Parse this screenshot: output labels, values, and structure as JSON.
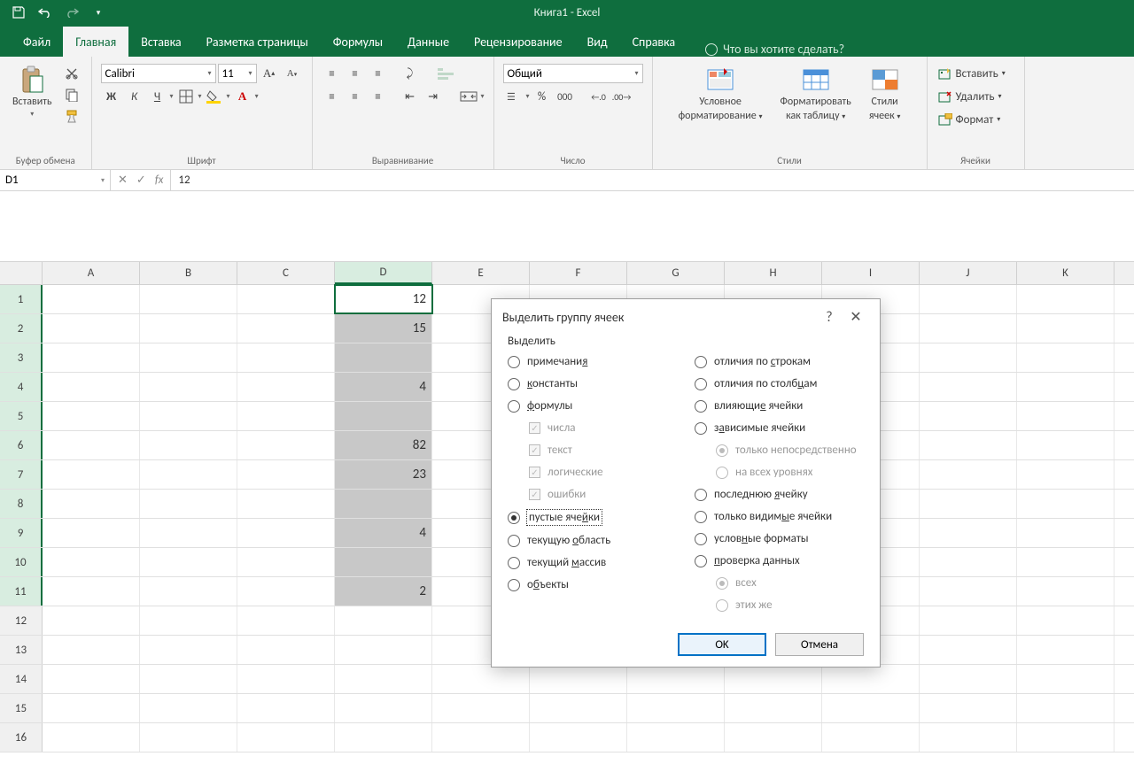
{
  "title": "Книга1  -  Excel",
  "tabs": {
    "file": "Файл",
    "home": "Главная",
    "insert": "Вставка",
    "page_layout": "Разметка страницы",
    "formulas": "Формулы",
    "data": "Данные",
    "review": "Рецензирование",
    "view": "Вид",
    "help": "Справка",
    "tell_me": "Что вы хотите сделать?"
  },
  "ribbon": {
    "clipboard": {
      "paste": "Вставить",
      "label": "Буфер обмена"
    },
    "font": {
      "name": "Calibri",
      "size": "11",
      "label": "Шрифт",
      "bold": "Ж",
      "italic": "К",
      "underline": "Ч"
    },
    "alignment": {
      "label": "Выравнивание"
    },
    "number": {
      "format": "Общий",
      "label": "Число"
    },
    "styles": {
      "conditional1": "Условное",
      "conditional2": "форматирование",
      "format_table1": "Форматировать",
      "format_table2": "как таблицу",
      "cell_styles1": "Стили",
      "cell_styles2": "ячеек",
      "label": "Стили"
    },
    "cells": {
      "insert": "Вставить",
      "delete": "Удалить",
      "format": "Формат",
      "label": "Ячейки"
    }
  },
  "formula_bar": {
    "name_box": "D1",
    "fx": "fx",
    "value": "12"
  },
  "grid": {
    "columns": [
      "A",
      "B",
      "C",
      "D",
      "E",
      "F",
      "G",
      "H",
      "I",
      "J",
      "K"
    ],
    "rows": [
      {
        "n": "1",
        "d": "12"
      },
      {
        "n": "2",
        "d": "15"
      },
      {
        "n": "3",
        "d": ""
      },
      {
        "n": "4",
        "d": "4"
      },
      {
        "n": "5",
        "d": ""
      },
      {
        "n": "6",
        "d": "82"
      },
      {
        "n": "7",
        "d": "23"
      },
      {
        "n": "8",
        "d": ""
      },
      {
        "n": "9",
        "d": "4"
      },
      {
        "n": "10",
        "d": ""
      },
      {
        "n": "11",
        "d": "2"
      },
      {
        "n": "12",
        "d": ""
      },
      {
        "n": "13",
        "d": ""
      },
      {
        "n": "14",
        "d": ""
      },
      {
        "n": "15",
        "d": ""
      },
      {
        "n": "16",
        "d": ""
      }
    ]
  },
  "dialog": {
    "title": "Выделить группу ячеек",
    "section": "Выделить",
    "help": "?",
    "close": "✕",
    "left": {
      "comments": "примечания",
      "comments_u": "я",
      "constants": "константы",
      "constants_u": "к",
      "formulas": "формулы",
      "formulas_u": "ф",
      "numbers": "числа",
      "text": "текст",
      "logicals": "логические",
      "errors": "ошибки",
      "blanks": "пустые ячейки",
      "blanks_u": "й",
      "current_region": "текущую область",
      "current_region_u": "о",
      "current_array": "текущий массив",
      "current_array_u": "м",
      "objects": "объекты",
      "objects_u": "б"
    },
    "right": {
      "row_diffs": "отличия по строкам",
      "row_diffs_u": "с",
      "col_diffs": "отличия по столбцам",
      "col_diffs_u": "ц",
      "precedents": "влияющие ячейки",
      "precedents_u": "е",
      "dependents": "зависимые ячейки",
      "dependents_u": "а",
      "direct_only": "только непосредственно",
      "all_levels": "на всех уровнях",
      "last_cell": "последнюю ячейку",
      "last_cell_u": "я",
      "visible_only": "только видимые ячейки",
      "visible_only_u": "ы",
      "cond_format": "условные форматы",
      "cond_format_u": "н",
      "data_validation": "проверка данных",
      "data_validation_u": "п",
      "all": "всех",
      "same": "этих же"
    },
    "ok": "OK",
    "cancel": "Отмена"
  }
}
